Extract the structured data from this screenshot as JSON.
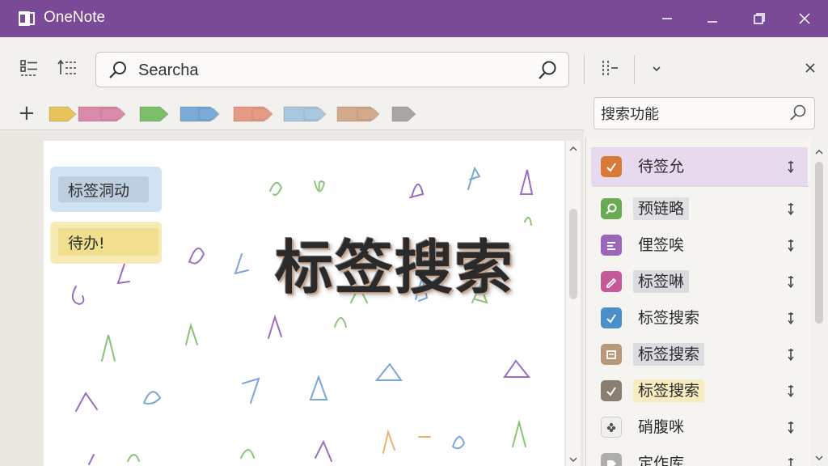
{
  "window": {
    "app_title": "OneNote",
    "icons": {
      "logo": "onenote-logo-icon",
      "minimize": "minimize-icon",
      "maximize": "restore-icon",
      "close": "close-icon"
    }
  },
  "toolbar": {
    "search_value": "Searcha",
    "icons": [
      "grid-view-icon",
      "sort-icon",
      "search-icon",
      "filter-icon",
      "chevron-down-icon",
      "close-icon"
    ]
  },
  "tag_strip": {
    "add_label": "+",
    "chips": [
      {
        "name": "tag-chip-yellow",
        "color": "#e8c25a"
      },
      {
        "name": "tag-chip-pink-purple",
        "color": "#d98aa8"
      },
      {
        "name": "tag-chip-green",
        "color": "#7cbf6a"
      },
      {
        "name": "tag-chip-blue",
        "color": "#7aaad6"
      },
      {
        "name": "tag-chip-salmon",
        "color": "#e59a86"
      },
      {
        "name": "tag-chip-lightblue",
        "color": "#a9c8e0"
      },
      {
        "name": "tag-chip-tan",
        "color": "#d2a98a"
      },
      {
        "name": "tag-chip-gray",
        "color": "#a8a6a3"
      }
    ]
  },
  "right_search": {
    "value": "搜索功能"
  },
  "canvas": {
    "notes": [
      {
        "text": "标签洞动",
        "bg": "#cfe3f3",
        "inner": "#bdcfdf"
      },
      {
        "text": "待办!",
        "bg": "#f6ebb4",
        "inner": "#efdf8f"
      }
    ],
    "headline": "标签搜索"
  },
  "results": [
    {
      "label": "待签允",
      "icon_color": "#d97a3a",
      "label_bg": "#e7d9ee",
      "icon": "checkmark-icon",
      "selected": true
    },
    {
      "label": "预链略",
      "icon_color": "#6aaa55",
      "label_bg": "#dfe0e4",
      "icon": "search-icon",
      "selected": false
    },
    {
      "label": "俚签唉",
      "icon_color": "#9a66b8",
      "label_bg": "",
      "icon": "list-icon",
      "selected": false
    },
    {
      "label": "标签啉",
      "icon_color": "#c45a9a",
      "label_bg": "#dcdbe0",
      "icon": "edit-icon",
      "selected": false
    },
    {
      "label": "标签搜索",
      "icon_color": "#4a8fc9",
      "label_bg": "",
      "icon": "checkmark-icon",
      "selected": false
    },
    {
      "label": "标签搜索",
      "icon_color": "#b89a7a",
      "label_bg": "#dcdbe0",
      "icon": "note-icon",
      "selected": false
    },
    {
      "label": "标签搜索",
      "icon_color": "#8a7d72",
      "label_bg": "#f6ecc0",
      "icon": "checkmark-icon",
      "selected": false
    },
    {
      "label": "硝腹咪",
      "icon_color": "#f0efed",
      "label_bg": "",
      "icon": "flower-icon",
      "selected": false
    },
    {
      "label": "定作库",
      "icon_color": "#b0aeab",
      "label_bg": "",
      "icon": "tag-icon",
      "selected": false
    }
  ]
}
